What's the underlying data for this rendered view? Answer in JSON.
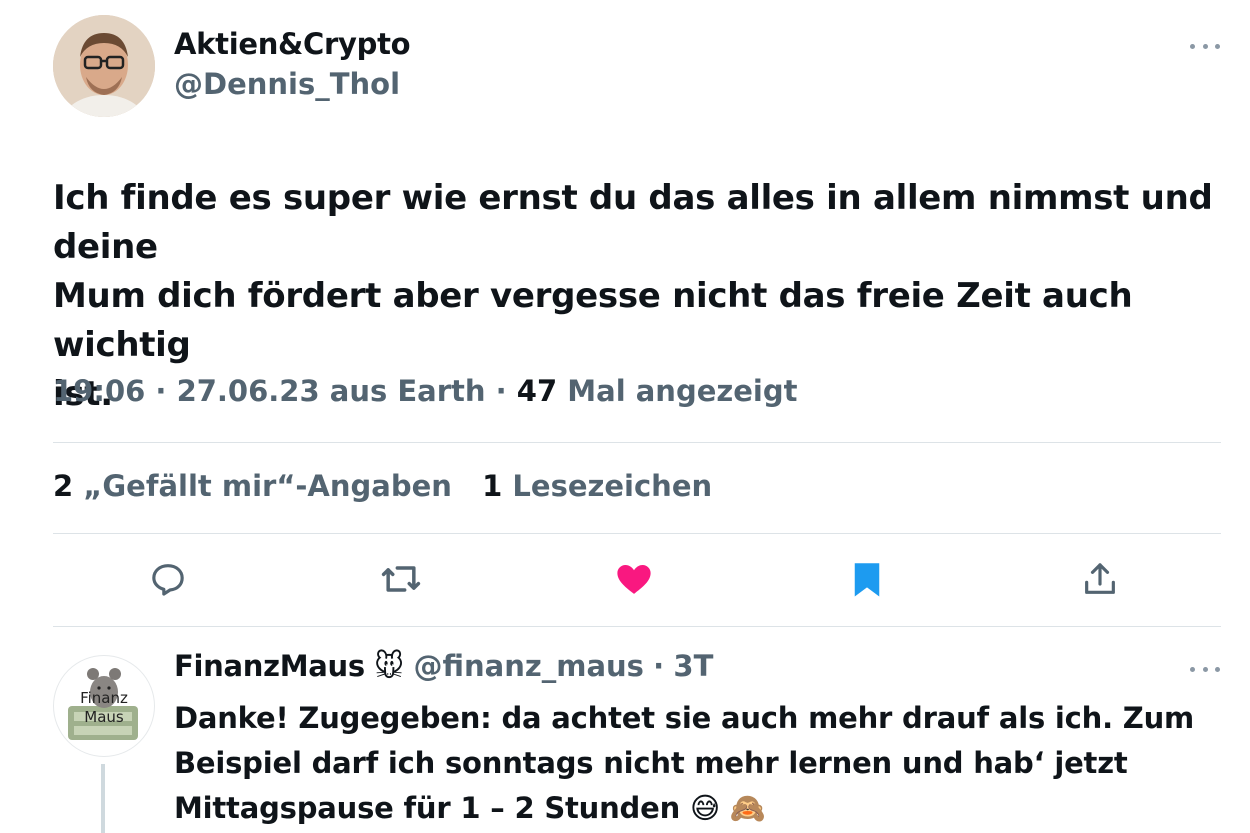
{
  "tweet": {
    "author_name": "Aktien&Crypto",
    "author_handle": "@Dennis_Thol",
    "text_line1": "Ich finde es super wie ernst du das alles in allem nimmst und deine",
    "text_line2": "Mum dich fördert aber vergesse nicht das freie Zeit auch wichtig",
    "text_line3": "ist.",
    "time": "19:06",
    "date": "27.06.23",
    "location": "aus Earth",
    "sep": "·",
    "views_count": "47",
    "views_label": "Mal angezeigt",
    "likes_count": "2",
    "likes_label": "„Gefällt mir“-Angaben",
    "bookmarks_count": "1",
    "bookmarks_label": "Lesezeichen"
  },
  "actions": {
    "reply_icon": "reply-icon",
    "retweet_icon": "retweet-icon",
    "like_icon": "heart-icon",
    "bookmark_icon": "bookmark-icon",
    "share_icon": "share-icon",
    "like_color": "#f91880",
    "bookmark_color": "#1d9bf0"
  },
  "reply": {
    "author_name": "FinanzMaus",
    "author_emoji": "🐭",
    "author_handle": "@finanz_maus",
    "sep": "·",
    "age": "3T",
    "avatar_text_line1": "Finanz",
    "avatar_text_line2": "Maus",
    "text_line1": "Danke! Zugegeben: da achtet sie auch mehr drauf als ich. Zum",
    "text_line2": "Beispiel darf ich sonntags nicht mehr lernen und hab‘ jetzt",
    "text_line3": "Mittagspause für 1 – 2 Stunden",
    "text_emoji": "😅 🙈"
  }
}
